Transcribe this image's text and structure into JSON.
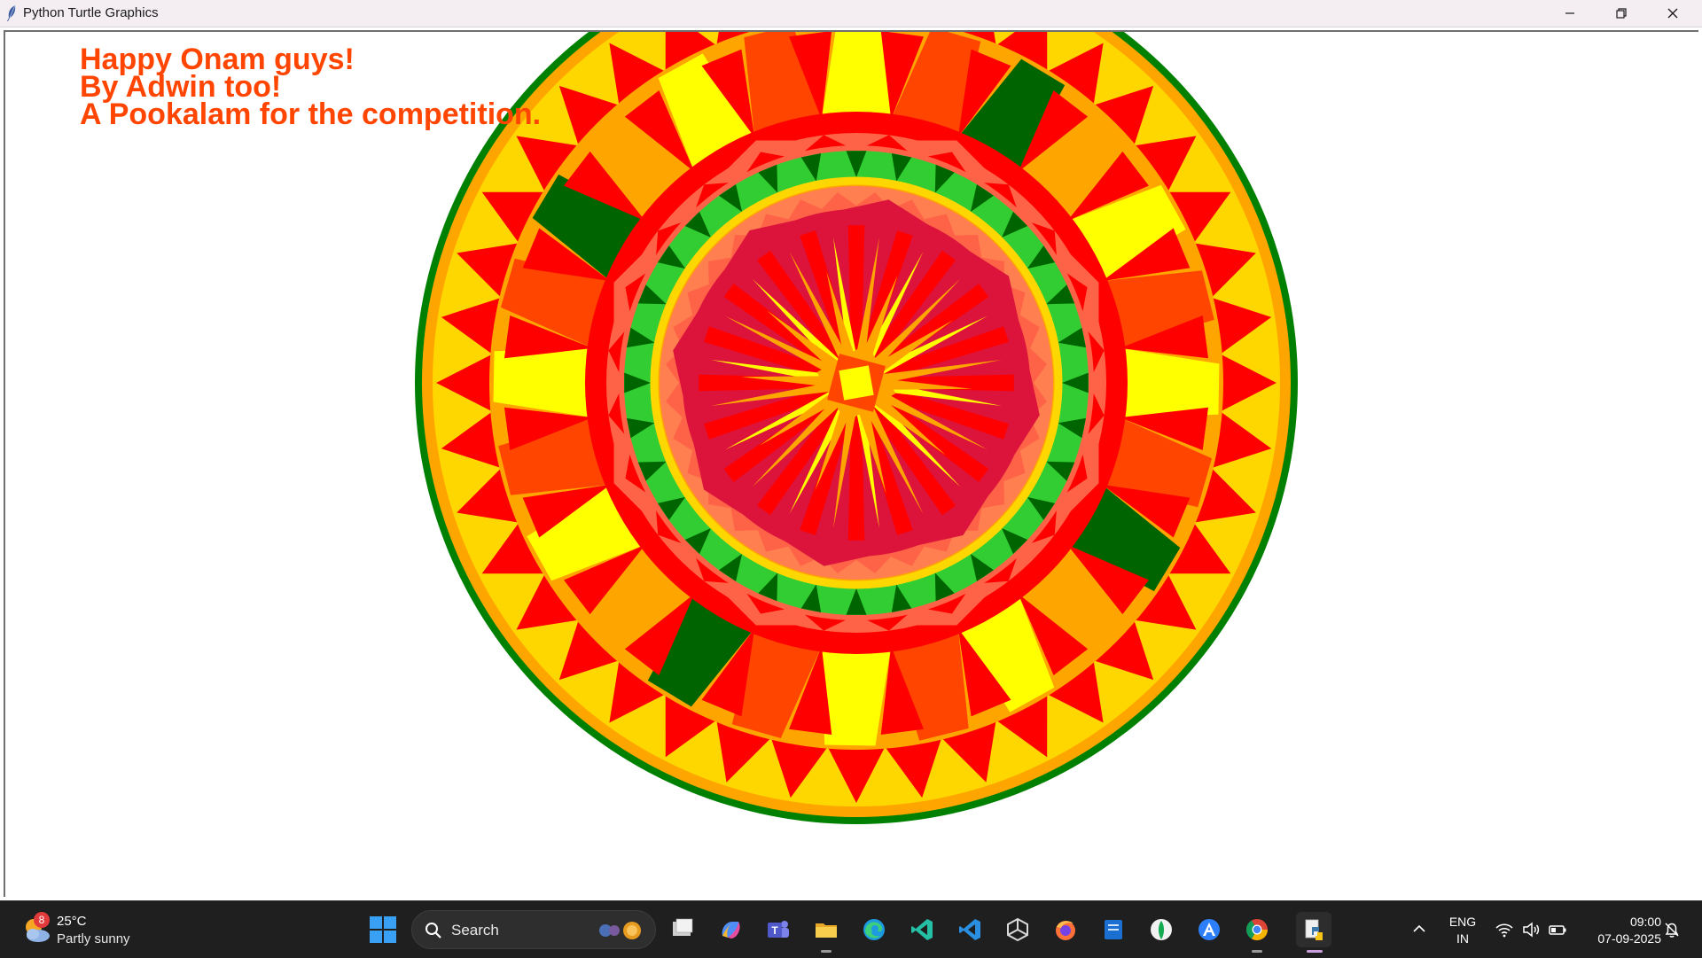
{
  "window": {
    "title": "Python Turtle Graphics"
  },
  "canvas": {
    "greeting_lines": [
      "Happy Onam guys!",
      "By Adwin too!",
      "A Pookalam for the competition."
    ],
    "text_color": "#ff4500"
  },
  "pookalam_colors": {
    "dark_green": "#008000",
    "orange": "#ffa500",
    "gold": "#ffd700",
    "red": "#ff0000",
    "yellow": "#ffff00",
    "orangered": "#ff4500",
    "deep_green": "#006400",
    "tomato": "#ff6347",
    "lime_green": "#32cd32",
    "crimson": "#dc143c",
    "salmon": "#ff7f50"
  },
  "taskbar": {
    "weather": {
      "badge": "8",
      "temperature": "25°C",
      "description": "Partly sunny"
    },
    "search": {
      "label": "Search"
    },
    "apps": [
      "task-view-icon",
      "copilot-icon",
      "teams-icon",
      "file-explorer-icon",
      "edge-icon",
      "vs-code-insiders-icon",
      "vs-code-icon",
      "unity-icon",
      "firefox-icon",
      "notes-icon",
      "mongodb-compass-icon",
      "app-icon-a",
      "chrome-icon",
      "python-icon"
    ],
    "language": {
      "line1": "ENG",
      "line2": "IN"
    },
    "clock": {
      "time": "09:00",
      "date": "07-09-2025"
    }
  }
}
